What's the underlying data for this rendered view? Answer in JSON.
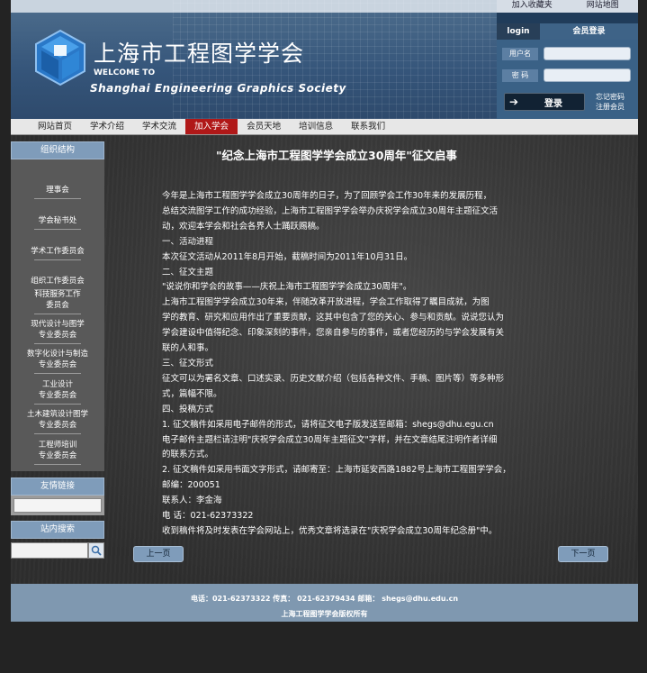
{
  "header": {
    "site_name_cn": "上海市工程图学学会",
    "welcome": "WELCOME TO",
    "site_name_en": "Shanghai Engineering Graphics Society",
    "top_links": [
      "加入收藏夹",
      "网站地图"
    ]
  },
  "login": {
    "tab_login": "login",
    "tab_member": "会员登录",
    "username_label": "用户名",
    "password_label": "密 码",
    "login_button": "登录",
    "forgot_password": "忘记密码",
    "register": "注册会员"
  },
  "nav": {
    "items": [
      "网站首页",
      "学术介绍",
      "学术交流",
      "加入学会",
      "会员天地",
      "培训信息",
      "联系我们"
    ],
    "active": "加入学会"
  },
  "sidebar": {
    "title": "组织结构",
    "items": [
      [
        "理事会"
      ],
      [
        "学会秘书处"
      ],
      [
        "学术工作委员会"
      ],
      [
        "组织工作委员会"
      ],
      [
        "科技服务工作",
        "委员会"
      ],
      [
        "现代设计与图学",
        "专业委员会"
      ],
      [
        "数字化设计与制造",
        "专业委员会"
      ],
      [
        "工业设计",
        "专业委员会"
      ],
      [
        "土木建筑设计图学",
        "专业委员会"
      ],
      [
        "工程师培训",
        "专业委员会"
      ]
    ],
    "friend_links_title": "友情链接",
    "search_title": "站内搜索"
  },
  "article": {
    "title": "\"纪念上海市工程图学学会成立30周年\"征文启事",
    "lines": [
      "今年是上海市工程图学学会成立30周年的日子，为了回顾学会工作30年来的发展历程，",
      "总结交流图学工作的成功经验，上海市工程图学学会举办庆祝学会成立30周年主题征文活",
      "动，欢迎本学会和社会各界人士踊跃赐稿。",
      "一、活动进程",
      "本次征文活动从2011年8月开始，截稿时间为2011年10月31日。",
      "二、征文主题",
      "\"说说你和学会的故事——庆祝上海市工程图学学会成立30周年\"。",
      "上海市工程图学学会成立30年来，伴随改革开放进程，学会工作取得了瞩目成就，为图",
      "学的教育、研究和应用作出了重要贡献，这其中包含了您的关心、参与和贡献。说说您认为",
      "学会建设中值得纪念、印象深刻的事件，您亲自参与的事件，或者您经历的与学会发展有关",
      "联的人和事。",
      "三、征文形式",
      "征文可以为署名文章、口述实录、历史文献介绍（包括各种文件、手稿、图片等）等多种形",
      "式，篇幅不限。",
      "四、投稿方式",
      "1. 征文稿件如采用电子邮件的形式，请将征文电子版发送至邮箱：shegs@dhu.egu.cn",
      "电子邮件主题栏请注明\"庆祝学会成立30周年主题征文\"字样，并在文章结尾注明作者详细",
      "的联系方式。",
      "2. 征文稿件如采用书面文字形式，请邮寄至：上海市延安西路1882号上海市工程图学学会，",
      "邮编：200051",
      "联系人：李金海",
      "电  话：021-62373322",
      "收到稿件将及时发表在学会网站上，优秀文章将选录在\"庆祝学会成立30周年纪念册\"中。"
    ],
    "prev": "上一页",
    "next": "下一页"
  },
  "footer": {
    "contact": "电话：021-62373322 传真： 021-62379434 邮箱： shegs@dhu.edu.cn",
    "copyright": "上海工程图学学会版权所有"
  },
  "colors": {
    "accent": "#7f9cba",
    "nav_active": "#b01818",
    "background": "#232323"
  }
}
